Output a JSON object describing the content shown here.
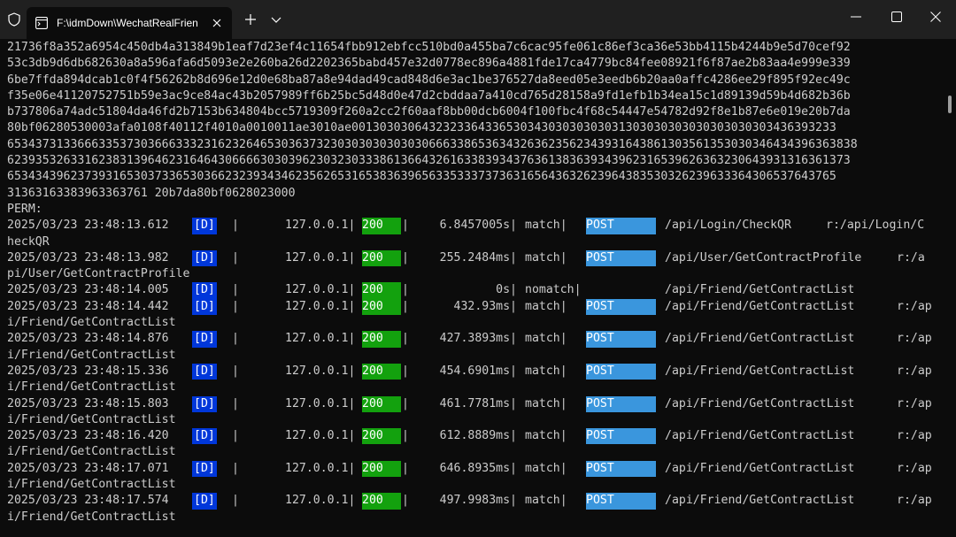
{
  "window": {
    "tab_title": "F:\\idmDown\\WechatRealFrien"
  },
  "icons": {
    "shield": "shield-icon",
    "tab": "terminal-icon",
    "close_tab": "close-icon",
    "new_tab": "plus-icon",
    "dropdown": "chevron-down-icon",
    "minimize": "minimize-icon",
    "maximize": "maximize-icon",
    "close_window": "close-icon"
  },
  "colors": {
    "level_bg": "#0037da",
    "status_bg": "#13a10e",
    "method_bg": "#3a96dd",
    "terminal_bg": "#0c0c0c",
    "text": "#cccccc"
  },
  "terminal": {
    "hex_lines": [
      "21736f8a352a6954c450db4a313849b1eaf7d23ef4c11654fbb912ebfcc510bd0a455ba7c6cac95fe061c86ef3ca36e53bb4115b4244b9e5d70cef92",
      "53c3db9d6db682630a8a596afa6d5093e2e260ba26d2202365babd457e32d0778ec896a4881fde17ca4779bc84fee08921f6f87ae2b83aa4e999e339",
      "6be7ffda894dcab1c0f4f56262b8d696e12d0e68ba87a8e94dad49cad848d6e3ac1be376527da8eed05e3eedb6b20aa0affc4286ee29f895f92ec49c",
      "f35e06e41120752751b59e3ac9ce84ac43b2057989ff6b25bc5d48d0e47d2cbddaa7a410cd765d28158a9fd1efb1b34ea15c1d89139d59b4d682b36b",
      "b737806a74adc51804da46fd2b7153b634804bcc5719309f260a2cc2f60aaf8bb00dcb6004f100fbc4f68c54447e54782d92f8e1b87e6e019e20b7da",
      "80bf06280530003afa0108f40112f4010a0010011ae3010ae001303030643232336433653034303030303031303030303030303030303436393233",
      "6534373133666335373036663332316232646530363732303030303030306663386536343263623562343931643861303561353030346434396363838",
      "623935326331623831396462316464306666303039623032303338613664326163383934376361383639343962316539626363230643931316361373",
      "6534343962373931653037336530366232393434623562653165383639656335333737363165643632623964383530326239633364306537643765",
      "31363163383963363761 20b7da80bf0628023000"
    ],
    "perm_label": "PERM:",
    "logs": [
      {
        "date": "2025/03/23 23:48:13.612",
        "level": "[D]",
        "pipe1": "|",
        "ip": "127.0.0.1|",
        "status": "200",
        "pipe2": "|",
        "duration": "6.8457005s|",
        "match": "match|",
        "method": "POST",
        "path": "/api/Login/CheckQR",
        "wrap": "r:/api/Login/C",
        "continuation": "heckQR"
      },
      {
        "date": "2025/03/23 23:48:13.982",
        "level": "[D]",
        "pipe1": "|",
        "ip": "127.0.0.1|",
        "status": "200",
        "pipe2": "|",
        "duration": "255.2484ms|",
        "match": "match|",
        "method": "POST",
        "path": "/api/User/GetContractProfile",
        "wrap": "r:/a",
        "continuation": "pi/User/GetContractProfile"
      },
      {
        "date": "2025/03/23 23:48:14.005",
        "level": "[D]",
        "pipe1": "|",
        "ip": "127.0.0.1|",
        "status": "200",
        "pipe2": "|",
        "duration": "0s|",
        "match": "nomatch|",
        "method": "",
        "path": "/api/Friend/GetContractList",
        "wrap": "",
        "continuation": ""
      },
      {
        "date": "2025/03/23 23:48:14.442",
        "level": "[D]",
        "pipe1": "|",
        "ip": "127.0.0.1|",
        "status": "200",
        "pipe2": "|",
        "duration": "432.93ms|",
        "match": "match|",
        "method": "POST",
        "path": "/api/Friend/GetContractList",
        "wrap": "r:/ap",
        "continuation": "i/Friend/GetContractList"
      },
      {
        "date": "2025/03/23 23:48:14.876",
        "level": "[D]",
        "pipe1": "|",
        "ip": "127.0.0.1|",
        "status": "200",
        "pipe2": "|",
        "duration": "427.3893ms|",
        "match": "match|",
        "method": "POST",
        "path": "/api/Friend/GetContractList",
        "wrap": "r:/ap",
        "continuation": "i/Friend/GetContractList"
      },
      {
        "date": "2025/03/23 23:48:15.336",
        "level": "[D]",
        "pipe1": "|",
        "ip": "127.0.0.1|",
        "status": "200",
        "pipe2": "|",
        "duration": "454.6901ms|",
        "match": "match|",
        "method": "POST",
        "path": "/api/Friend/GetContractList",
        "wrap": "r:/ap",
        "continuation": "i/Friend/GetContractList"
      },
      {
        "date": "2025/03/23 23:48:15.803",
        "level": "[D]",
        "pipe1": "|",
        "ip": "127.0.0.1|",
        "status": "200",
        "pipe2": "|",
        "duration": "461.7781ms|",
        "match": "match|",
        "method": "POST",
        "path": "/api/Friend/GetContractList",
        "wrap": "r:/ap",
        "continuation": "i/Friend/GetContractList"
      },
      {
        "date": "2025/03/23 23:48:16.420",
        "level": "[D]",
        "pipe1": "|",
        "ip": "127.0.0.1|",
        "status": "200",
        "pipe2": "|",
        "duration": "612.8889ms|",
        "match": "match|",
        "method": "POST",
        "path": "/api/Friend/GetContractList",
        "wrap": "r:/ap",
        "continuation": "i/Friend/GetContractList"
      },
      {
        "date": "2025/03/23 23:48:17.071",
        "level": "[D]",
        "pipe1": "|",
        "ip": "127.0.0.1|",
        "status": "200",
        "pipe2": "|",
        "duration": "646.8935ms|",
        "match": "match|",
        "method": "POST",
        "path": "/api/Friend/GetContractList",
        "wrap": "r:/ap",
        "continuation": "i/Friend/GetContractList"
      },
      {
        "date": "2025/03/23 23:48:17.574",
        "level": "[D]",
        "pipe1": "|",
        "ip": "127.0.0.1|",
        "status": "200",
        "pipe2": "|",
        "duration": "497.9983ms|",
        "match": "match|",
        "method": "POST",
        "path": "/api/Friend/GetContractList",
        "wrap": "r:/ap",
        "continuation": "i/Friend/GetContractList"
      }
    ]
  }
}
